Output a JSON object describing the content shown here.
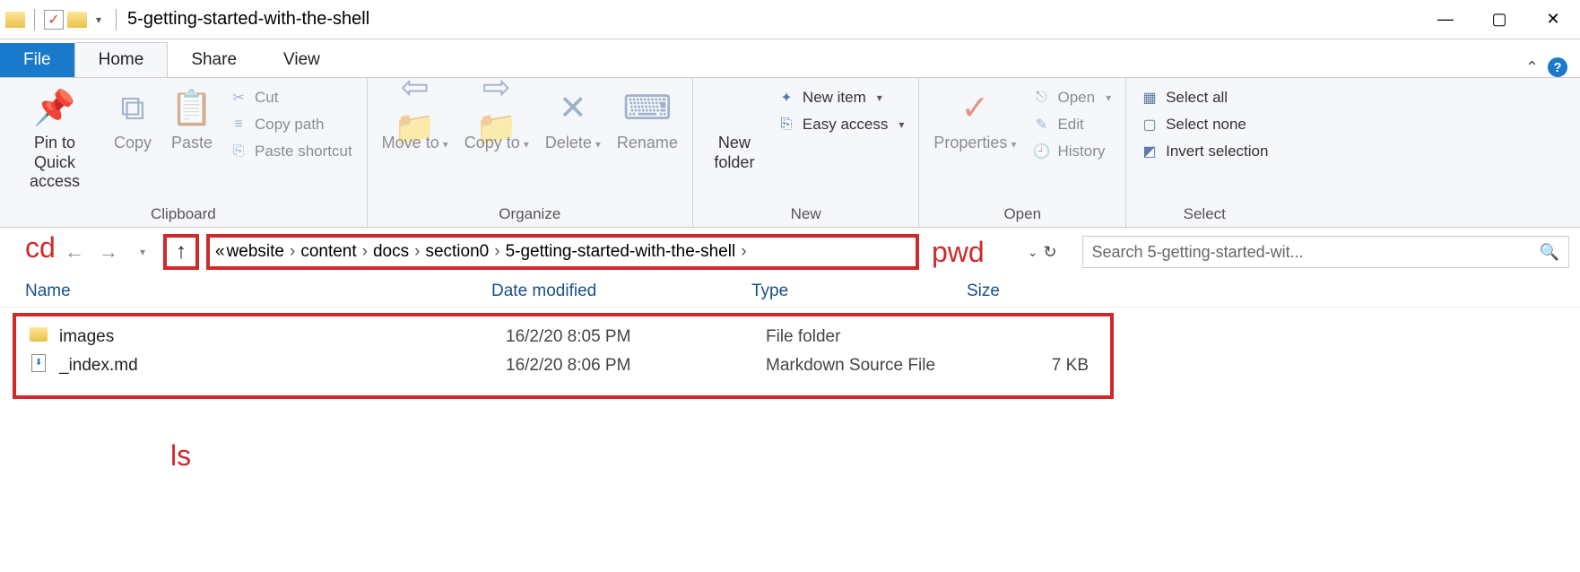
{
  "window": {
    "title": "5-getting-started-with-the-shell"
  },
  "tabs": {
    "file": "File",
    "home": "Home",
    "share": "Share",
    "view": "View"
  },
  "ribbon": {
    "clipboard": {
      "title": "Clipboard",
      "pin": "Pin to Quick access",
      "copy": "Copy",
      "paste": "Paste",
      "cut": "Cut",
      "copy_path": "Copy path",
      "paste_shortcut": "Paste shortcut"
    },
    "organize": {
      "title": "Organize",
      "move_to": "Move to",
      "copy_to": "Copy to",
      "delete": "Delete",
      "rename": "Rename"
    },
    "new": {
      "title": "New",
      "new_folder": "New folder",
      "new_item": "New item",
      "easy_access": "Easy access"
    },
    "open": {
      "title": "Open",
      "properties": "Properties",
      "open": "Open",
      "edit": "Edit",
      "history": "History"
    },
    "select": {
      "title": "Select",
      "select_all": "Select all",
      "select_none": "Select none",
      "invert": "Invert selection"
    }
  },
  "breadcrumbs": [
    "website",
    "content",
    "docs",
    "section0",
    "5-getting-started-with-the-shell"
  ],
  "search_placeholder": "Search 5-getting-started-wit...",
  "columns": {
    "name": "Name",
    "date": "Date modified",
    "type": "Type",
    "size": "Size"
  },
  "files": [
    {
      "name": "images",
      "date": "16/2/20 8:05 PM",
      "type": "File folder",
      "size": "",
      "icon": "folder"
    },
    {
      "name": "_index.md",
      "date": "16/2/20 8:06 PM",
      "type": "Markdown Source File",
      "size": "7 KB",
      "icon": "file"
    }
  ],
  "annotations": {
    "cd": "cd",
    "pwd": "pwd",
    "ls": "ls"
  }
}
